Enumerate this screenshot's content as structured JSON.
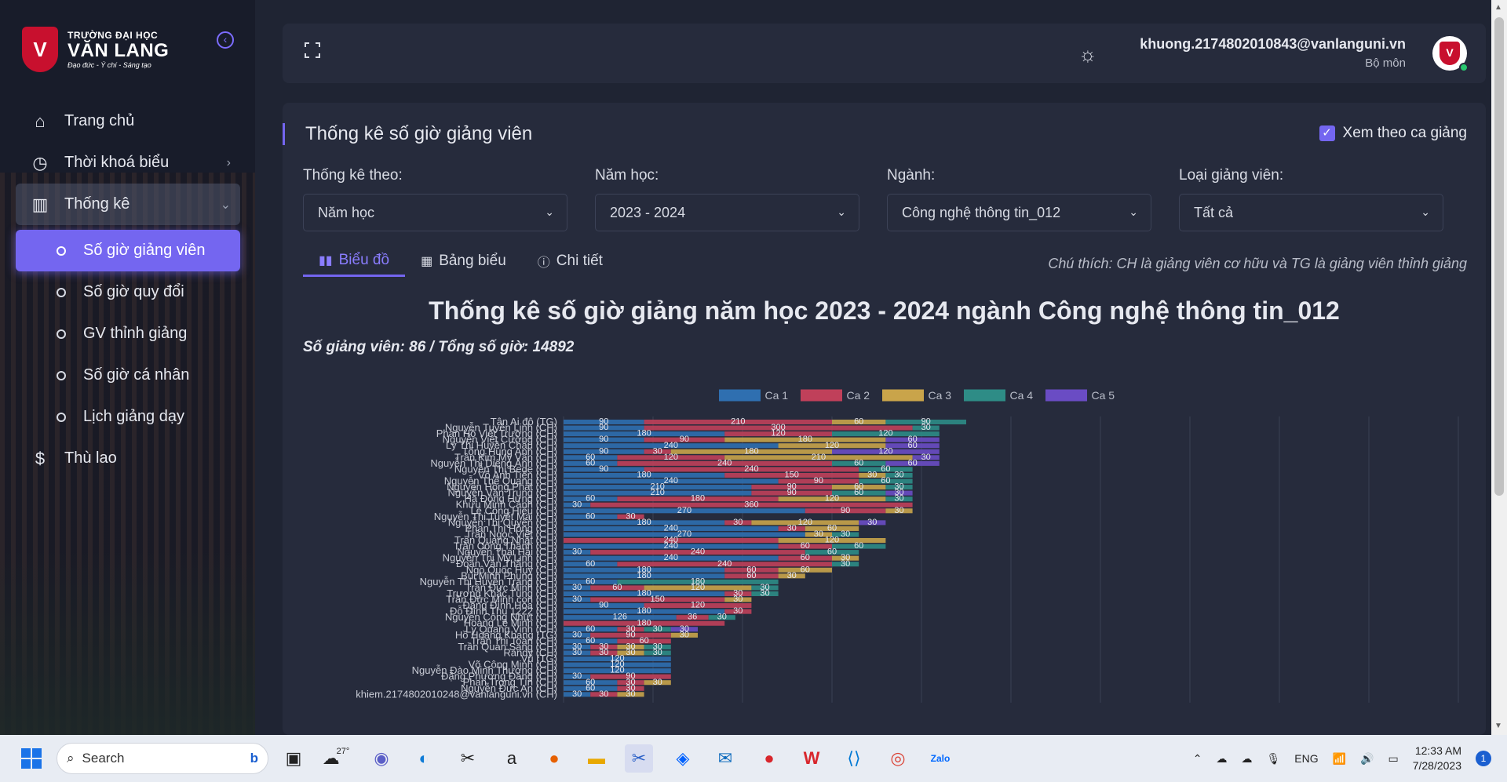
{
  "brand": {
    "line1": "TRƯỜNG ĐẠI HỌC",
    "line2": "VĂN LANG",
    "line3": "Đạo đức - Ý chí - Sáng tạo",
    "shield": "V"
  },
  "sidebar": {
    "items": [
      {
        "label": "Trang chủ",
        "icon": "home-icon"
      },
      {
        "label": "Thời khoá biểu",
        "icon": "clock-icon"
      },
      {
        "label": "Thống kê",
        "icon": "chart-icon"
      },
      {
        "label": "Thù lao",
        "icon": "dollar-icon"
      }
    ],
    "sub": [
      {
        "label": "Số giờ giảng viên"
      },
      {
        "label": "Số giờ quy đổi"
      },
      {
        "label": "GV thỉnh giảng"
      },
      {
        "label": "Số giờ cá nhân"
      },
      {
        "label": "Lịch giảng dạy"
      }
    ]
  },
  "header": {
    "email": "khuong.2174802010843@vanlanguni.vn",
    "role": "Bộ môn"
  },
  "page": {
    "title": "Thống kê số giờ giảng viên",
    "checkbox_label": "Xem theo ca giảng",
    "filters": [
      {
        "label": "Thống kê theo:",
        "value": "Năm học"
      },
      {
        "label": "Năm học:",
        "value": "2023 - 2024"
      },
      {
        "label": "Ngành:",
        "value": "Công nghệ thông tin_012"
      },
      {
        "label": "Loại giảng viên:",
        "value": "Tất cả"
      }
    ],
    "tabs": [
      {
        "label": "Biểu đồ"
      },
      {
        "label": "Bảng biểu"
      },
      {
        "label": "Chi tiết"
      }
    ],
    "note": "Chú thích: CH là giảng viên cơ hữu và TG là giảng viên thỉnh giảng"
  },
  "chart_data": {
    "type": "bar",
    "orientation": "horizontal-stacked",
    "title": "Thống kê số giờ giảng năm học 2023 - 2024 ngành Công nghệ thông tin_012",
    "subtitle": "Số giảng viên: 86 / Tổng số giờ: 14892",
    "legend_position": "top",
    "grid": true,
    "series": [
      {
        "name": "Ca 1",
        "color": "#2f6fb0"
      },
      {
        "name": "Ca 2",
        "color": "#c0405a"
      },
      {
        "name": "Ca 3",
        "color": "#c9a44a"
      },
      {
        "name": "Ca 4",
        "color": "#2e8c86"
      },
      {
        "name": "Ca 5",
        "color": "#6a4cc4"
      }
    ],
    "categories": [
      "Tân Ai đô (TG)",
      "Nguyễn Tuyền Linh (CH)",
      "Phan Hồ Viết Trường (CH)",
      "Nguyễn Việt Cường (CH)",
      "Lý Thị Huyền Châu (CH)",
      "Tống Hùng Anh (CH)",
      "Trần Kim Mỹ Vân (CH)",
      "Nguyễn Thị Diệng Ánh (CH)",
      "Nguyễn Thị Bede (CH)",
      "Võ Anh Tiến (CH)",
      "Nguyễn Thế Quang (CH)",
      "Nguyễn Hồng Phát (CH)",
      "Nguyễn Văn Trung (CH)",
      "Hà Đồng Hưng (CH)",
      "Khưu Minh Cảnh (CH)",
      "Lê Công Hiếu (CH)",
      "Nguyễn Thị Tuyết Mai (CH)",
      "Nguyễn Thị Quyên (CH)",
      "Phan Thị Hồng (CH)",
      "Trần Ngọc Việt (CH)",
      "Trần Quang Nhật (CH)",
      "Trần Công Thành (CH)",
      "Nguyễn Thái Hải (CH)",
      "Nguyễn Thị Mỹ Linh (CH)",
      "Đoàn Văn Thắng (CH)",
      "Ngô Quốc Huy (CH)",
      "Bùi Minh Phụng (CH)",
      "Nguyễn Thị Huyền Trang (CH)",
      "Trần Đức Minh (CH)",
      "Trương Khắc Tùng (CH)",
      "Trần Đức Minh con (CH)",
      "Đặng Đình Hòa (CH)",
      "Đỗ Đình Thu 1222 (CH)",
      "Nguyễn Công Nhựt (CH)",
      "Hoàng Lê Minh (CH)",
      "Lý Quang Vinh (CH)",
      "Hồ Hoàng Khang (TG)",
      "Trần Thị Toàn (CH)",
      "Trần Quan Sang (CH)",
      "Randy (CH)",
      "Vũ (TG)",
      "Võ Công Minh (CH)",
      "Nguyễn Đào Minh Thương (CH)",
      "Đặng Phương Đăng (CH)",
      "Phan Trọng Tín (CH)",
      "Nguyễn Đức An (CH)",
      "khiem.2174802010248@vanlanguni.vn (CH)"
    ],
    "values": [
      [
        90,
        210,
        60,
        90,
        0
      ],
      [
        90,
        300,
        0,
        30,
        0
      ],
      [
        180,
        120,
        0,
        120,
        0
      ],
      [
        90,
        90,
        180,
        0,
        60
      ],
      [
        240,
        0,
        120,
        0,
        60
      ],
      [
        90,
        30,
        180,
        0,
        120
      ],
      [
        60,
        120,
        210,
        0,
        30
      ],
      [
        60,
        240,
        0,
        60,
        60
      ],
      [
        90,
        240,
        0,
        60,
        0
      ],
      [
        180,
        150,
        30,
        30,
        0
      ],
      [
        240,
        90,
        0,
        60,
        0
      ],
      [
        210,
        90,
        60,
        30,
        0
      ],
      [
        210,
        90,
        0,
        60,
        30
      ],
      [
        60,
        180,
        120,
        30,
        0
      ],
      [
        30,
        360,
        0,
        0,
        0
      ],
      [
        270,
        90,
        30,
        0,
        0
      ],
      [
        60,
        30,
        0,
        0,
        0
      ],
      [
        180,
        30,
        120,
        0,
        30
      ],
      [
        240,
        30,
        60,
        0,
        0
      ],
      [
        270,
        0,
        30,
        30,
        0
      ],
      [
        0,
        240,
        120,
        0,
        0
      ],
      [
        240,
        60,
        0,
        60,
        0
      ],
      [
        30,
        240,
        0,
        60,
        0
      ],
      [
        240,
        60,
        30,
        0,
        0
      ],
      [
        60,
        240,
        0,
        30,
        0
      ],
      [
        180,
        60,
        60,
        0,
        0
      ],
      [
        180,
        60,
        30,
        0,
        0
      ],
      [
        60,
        0,
        0,
        180,
        0
      ],
      [
        30,
        60,
        120,
        30,
        0
      ],
      [
        180,
        30,
        0,
        30,
        0
      ],
      [
        30,
        150,
        30,
        0,
        0
      ],
      [
        90,
        120,
        0,
        0,
        0
      ],
      [
        180,
        30,
        0,
        0,
        0
      ],
      [
        126,
        36,
        0,
        30,
        0
      ],
      [
        0,
        180,
        0,
        0,
        0
      ],
      [
        60,
        30,
        0,
        30,
        30
      ],
      [
        30,
        90,
        30,
        0,
        0
      ],
      [
        60,
        60,
        0,
        0,
        0
      ],
      [
        30,
        30,
        30,
        30,
        0
      ],
      [
        30,
        30,
        30,
        30,
        0
      ],
      [
        120,
        0,
        0,
        0,
        0
      ],
      [
        120,
        0,
        0,
        0,
        0
      ],
      [
        120,
        0,
        0,
        0,
        0
      ],
      [
        30,
        90,
        0,
        0,
        0
      ],
      [
        60,
        30,
        30,
        0,
        0
      ],
      [
        60,
        30,
        0,
        0,
        0
      ],
      [
        30,
        30,
        30,
        0,
        0
      ]
    ],
    "xlim": [
      0,
      1000
    ]
  },
  "taskbar": {
    "search": "Search",
    "weather": "27°",
    "lang": "ENG",
    "time": "12:33 AM",
    "date": "7/28/2023",
    "notif": "1"
  }
}
